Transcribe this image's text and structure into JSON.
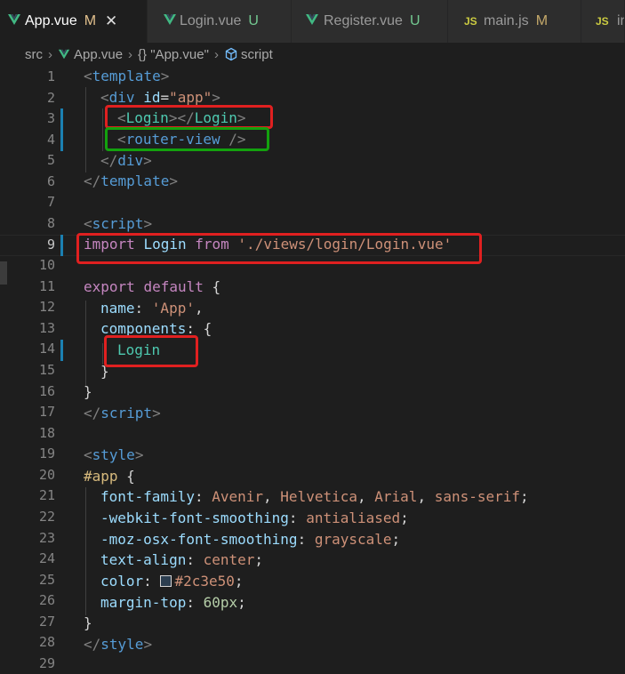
{
  "tabs": [
    {
      "label": "App.vue",
      "status": "M",
      "icon": "vue-icon",
      "active": true
    },
    {
      "label": "Login.vue",
      "status": "U",
      "icon": "vue-icon"
    },
    {
      "label": "Register.vue",
      "status": "U",
      "icon": "vue-icon"
    },
    {
      "label": "main.js",
      "status": "M",
      "icon": "js-icon"
    },
    {
      "label": "in",
      "icon": "js-icon"
    }
  ],
  "close_glyph": "✕",
  "js_badge": "JS",
  "breadcrumb": {
    "folder": "src",
    "file": "App.vue",
    "node": "{} \"App.vue\"",
    "section": "script"
  },
  "editor": {
    "active_line": 9,
    "line_numbers": [
      "1",
      "2",
      "3",
      "4",
      "5",
      "6",
      "7",
      "8",
      "9",
      "10",
      "11",
      "12",
      "13",
      "14",
      "15",
      "16",
      "17",
      "18",
      "19",
      "20",
      "21",
      "22",
      "23",
      "24",
      "25",
      "26",
      "27",
      "28",
      "29"
    ]
  },
  "code": {
    "l1": [
      "<",
      "template",
      ">"
    ],
    "l2": [
      "<",
      "div",
      "id",
      "=",
      "\"app\"",
      ">"
    ],
    "l3": [
      "<",
      "Login",
      "></",
      "Login",
      ">"
    ],
    "l4": [
      "<",
      "router-view",
      " />"
    ],
    "l5": [
      "</",
      "div",
      ">"
    ],
    "l6": [
      "</",
      "template",
      ">"
    ],
    "l8": [
      "<",
      "script",
      ">"
    ],
    "l9": [
      "import",
      "Login",
      "from",
      "'./views/login/Login.vue'"
    ],
    "l11": [
      "export",
      "default",
      "{"
    ],
    "l12": [
      "name",
      ": ",
      "'App'",
      ","
    ],
    "l13": [
      "components",
      ": {"
    ],
    "l14": [
      "Login"
    ],
    "l15": [
      "}"
    ],
    "l16": [
      "}"
    ],
    "l17": [
      "</",
      "script",
      ">"
    ],
    "l19": [
      "<",
      "style",
      ">"
    ],
    "l20": [
      "#app",
      " {"
    ],
    "l21": [
      "font-family",
      ": ",
      "Avenir",
      ", ",
      "Helvetica",
      ", ",
      "Arial",
      ", ",
      "sans-serif",
      ";"
    ],
    "l22": [
      "-webkit-font-smoothing",
      ": ",
      "antialiased",
      ";"
    ],
    "l23": [
      "-moz-osx-font-smoothing",
      ": ",
      "grayscale",
      ";"
    ],
    "l24": [
      "text-align",
      ": ",
      "center",
      ";"
    ],
    "l25": [
      "color",
      ": ",
      "#2c3e50",
      ";"
    ],
    "l26": [
      "margin-top",
      ": ",
      "60px",
      ";"
    ],
    "l27": [
      "}"
    ],
    "l28": [
      "</",
      "style",
      ">"
    ]
  },
  "colors": {
    "vue": "#41b883",
    "js": "#cbcb41",
    "annotation_red": "#e02020",
    "annotation_green": "#13a10e",
    "swatch": "#2c3e50"
  }
}
